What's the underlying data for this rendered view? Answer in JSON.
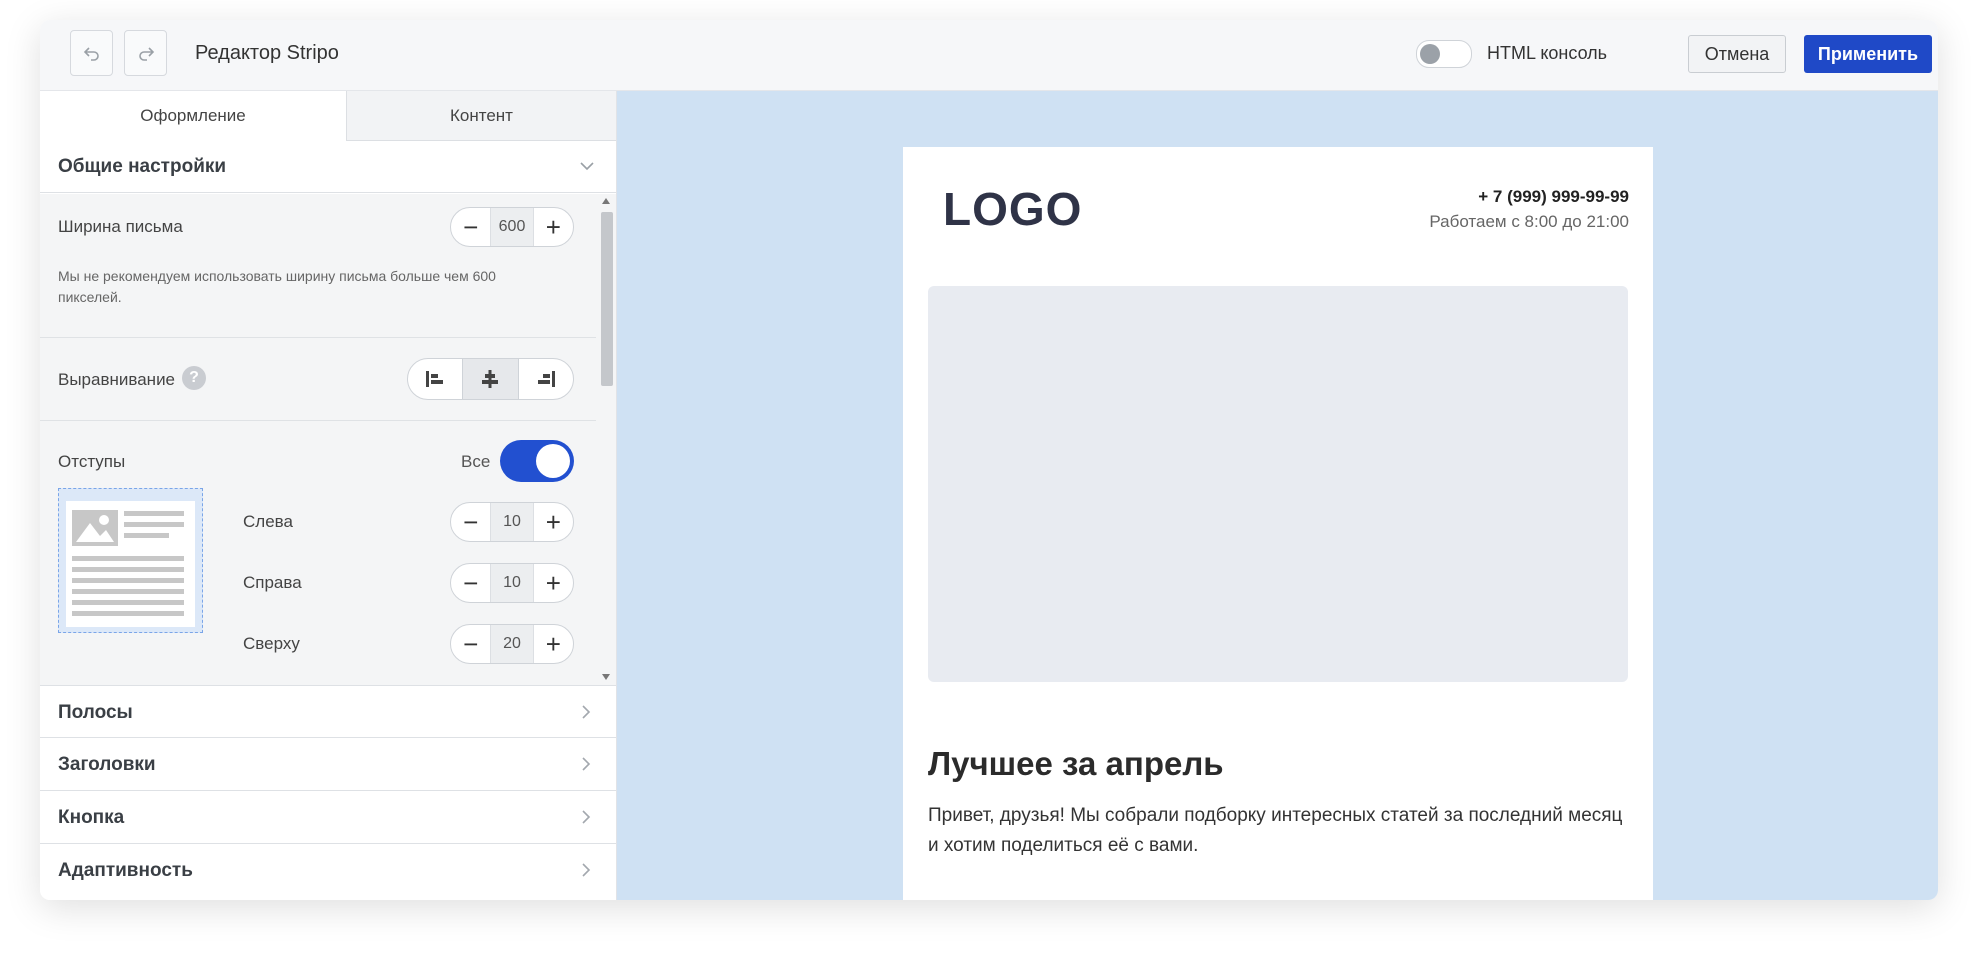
{
  "header": {
    "title": "Редактор Stripo",
    "undo_icon": "undo-icon",
    "redo_icon": "redo-icon",
    "console_label": "HTML консоль",
    "console_enabled": false,
    "cancel_label": "Отмена",
    "apply_label": "Применить",
    "accent_color": "#1f49c7"
  },
  "sidebar": {
    "tabs": [
      {
        "label": "Оформление",
        "active": true
      },
      {
        "label": "Контент",
        "active": false
      }
    ],
    "general_settings": {
      "title": "Общие настройки",
      "email_width_label": "Ширина письма",
      "email_width_value": "600",
      "width_note": "Мы не рекомендуем использовать ширину письма больше чем 600 пикселей.",
      "alignment_label": "Выравнивание",
      "alignment_help": "?",
      "alignment_selected": "center",
      "padding_label": "Отступы",
      "padding_all_label": "Все",
      "padding_all_enabled": true,
      "padding_left_label": "Слева",
      "padding_left_value": "10",
      "padding_right_label": "Справа",
      "padding_right_value": "10",
      "padding_top_label": "Сверху",
      "padding_top_value": "20"
    },
    "collapsed_sections": [
      {
        "label": "Полосы"
      },
      {
        "label": "Заголовки"
      },
      {
        "label": "Кнопка"
      },
      {
        "label": "Адаптивность"
      }
    ]
  },
  "email_preview": {
    "logo_text": "LOGO",
    "phone": "+ 7 (999) 999-99-99",
    "hours": "Работаем с 8:00 до 21:00",
    "headline": "Лучшее за апрель",
    "body": "Привет, друзья! Мы собрали подборку интересных статей за последний месяц и хотим поделиться её с вами.",
    "canvas_color": "#cfe1f3"
  }
}
